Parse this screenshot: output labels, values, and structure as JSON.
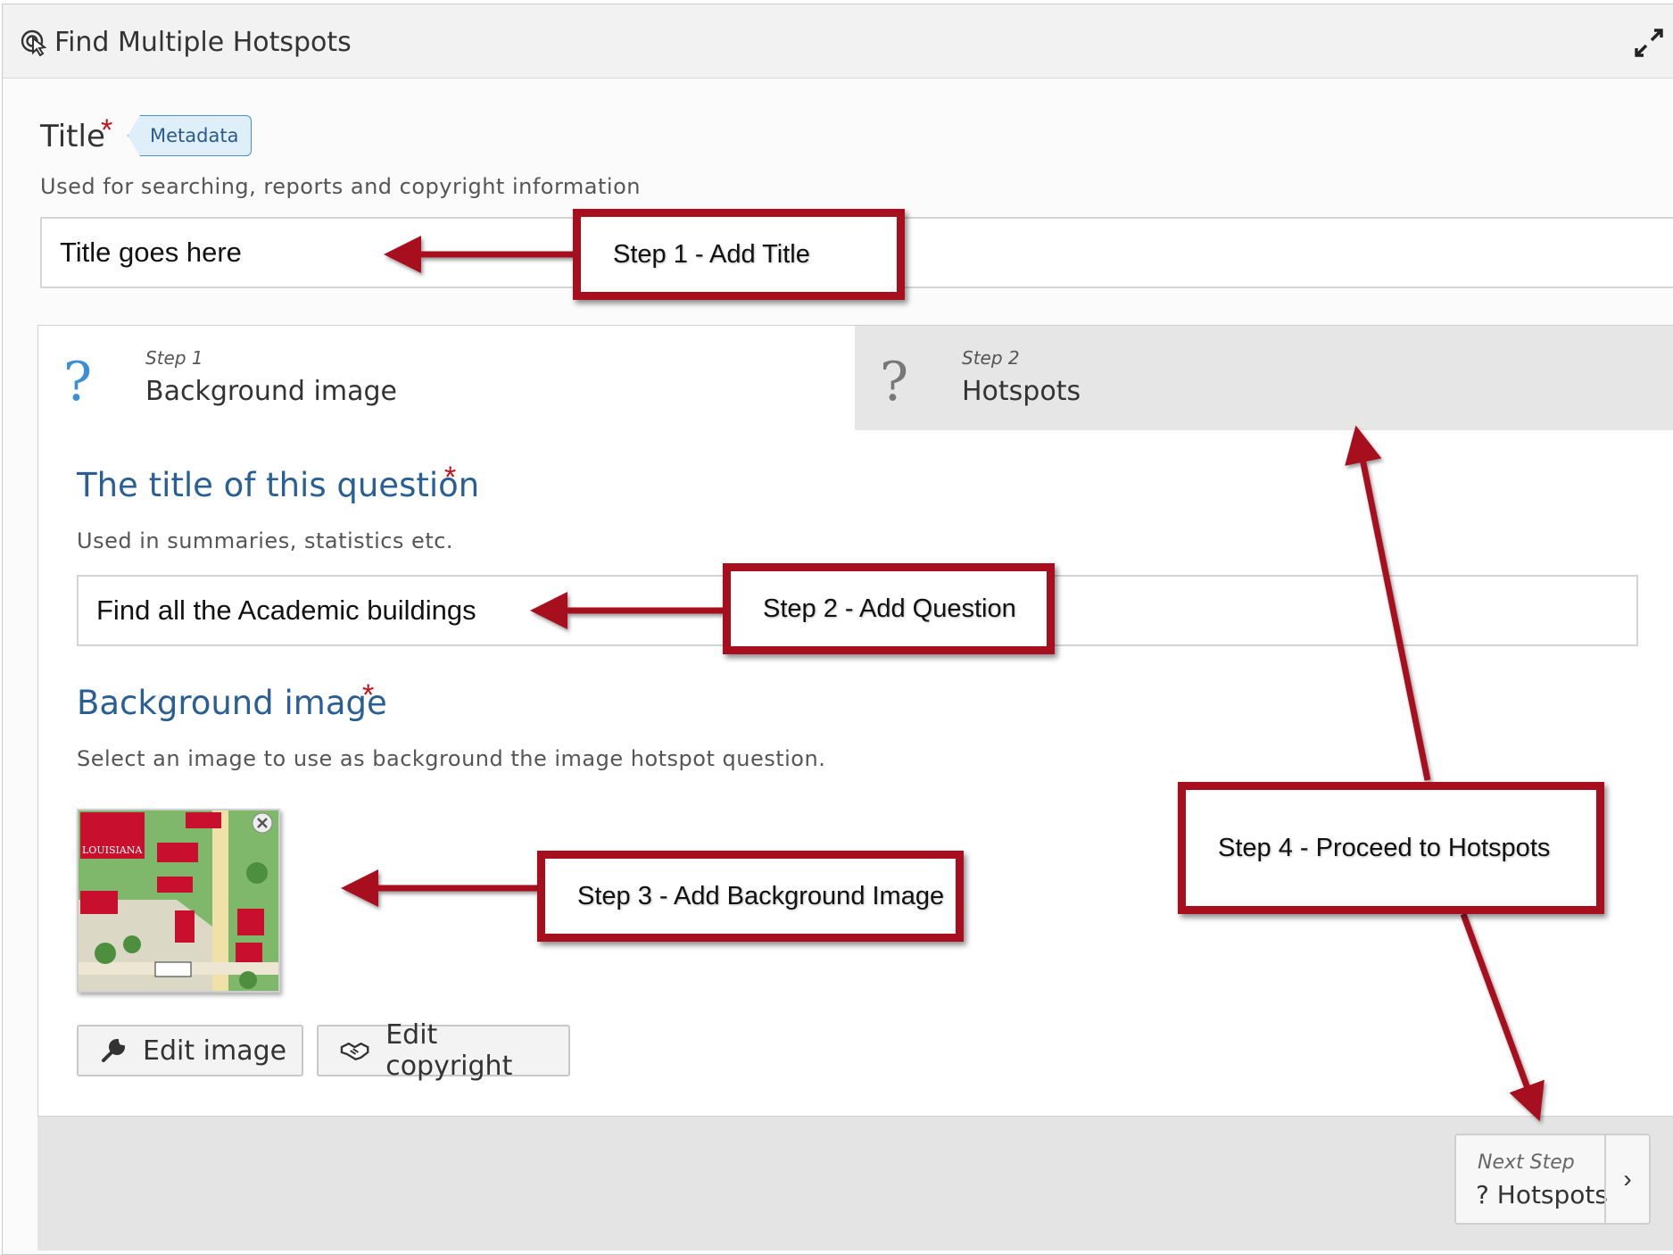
{
  "header": {
    "title": "Find Multiple Hotspots",
    "icon": "hotspot-icon",
    "expand_icon": "expand-icon"
  },
  "title_field": {
    "label": "Title",
    "required_mark": "*",
    "tag": "Metadata",
    "help": "Used for searching, reports and copyright information",
    "value": "Title goes here"
  },
  "wizard": {
    "tabs": [
      {
        "step": "Step 1",
        "name": "Background image",
        "icon": "?",
        "active": true
      },
      {
        "step": "Step 2",
        "name": "Hotspots",
        "icon": "?",
        "active": false
      }
    ]
  },
  "question_field": {
    "label": "The title of this question",
    "required_mark": "*",
    "help": "Used in summaries, statistics etc.",
    "value": "Find all the Academic buildings"
  },
  "background_field": {
    "label": "Background image",
    "required_mark": "*",
    "help": "Select an image to use as background the image hotspot question.",
    "thumbnail_caption": "LOUISIANA",
    "edit_image": "Edit image",
    "edit_copyright": "Edit copyright"
  },
  "next_step": {
    "label": "Next Step",
    "name": "? Hotspots",
    "arrow": "›"
  },
  "callouts": {
    "step1": "Step 1 - Add Title",
    "step2": "Step 2 - Add Question",
    "step3": "Step 3 - Add Background Image",
    "step4": "Step 4 - Proceed to Hotspots"
  },
  "colors": {
    "accent_blue": "#2a5f95",
    "required_red": "#c0121b",
    "callout_red": "#a80f1e",
    "tab_inactive": "#e6e6e6"
  }
}
